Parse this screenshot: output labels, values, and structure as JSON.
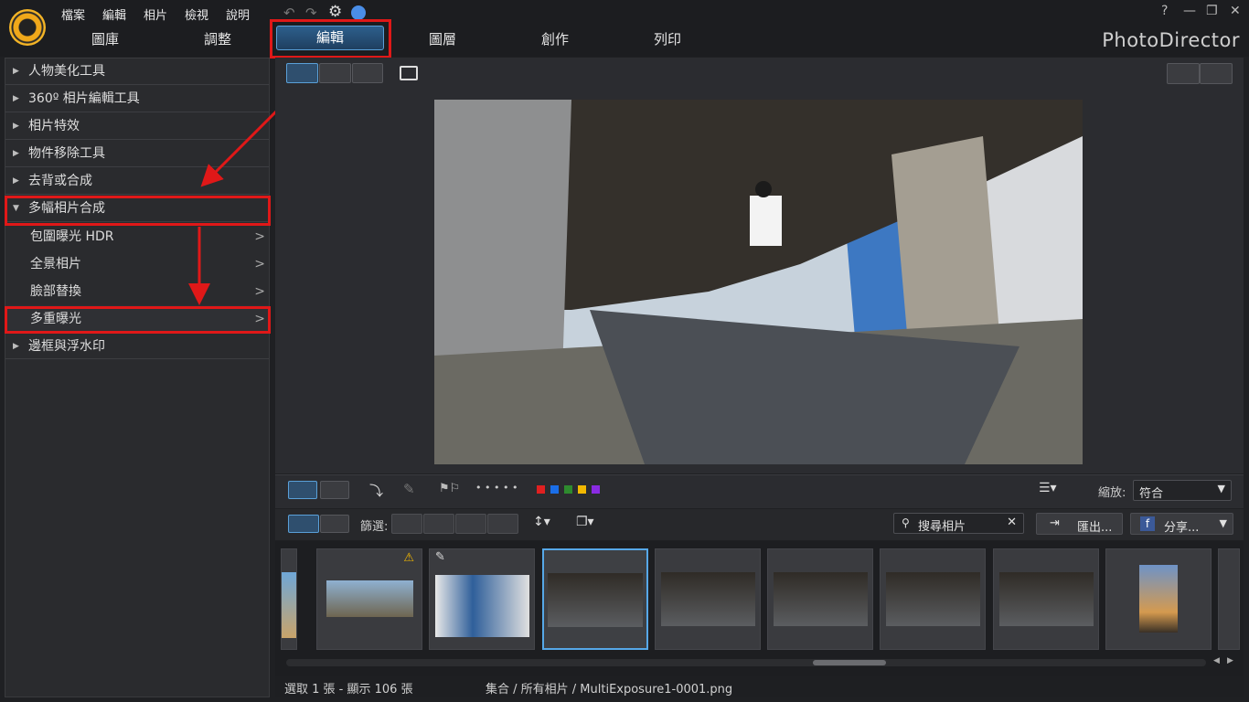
{
  "menu": [
    "檔案",
    "編輯",
    "相片",
    "檢視",
    "說明"
  ],
  "tabs": {
    "library": "圖庫",
    "adjust": "調整",
    "edit": "編輯",
    "layers": "圖層",
    "create": "創作",
    "print": "列印"
  },
  "brand": "PhotoDirector",
  "window": {
    "help": "?",
    "minimize": "—",
    "restore": "❐",
    "close": "✕"
  },
  "left_panel": {
    "items": [
      {
        "label": "人物美化工具"
      },
      {
        "label": "360º 相片編輯工具"
      },
      {
        "label": "相片特效"
      },
      {
        "label": "物件移除工具"
      },
      {
        "label": "去背或合成"
      },
      {
        "label": "多幅相片合成"
      },
      {
        "label": "邊框與浮水印"
      }
    ],
    "subitems": [
      {
        "label": "包圍曝光 HDR"
      },
      {
        "label": "全景相片"
      },
      {
        "label": "臉部替換"
      },
      {
        "label": "多重曝光"
      }
    ]
  },
  "lower_toolbar": {
    "zoom_label": "縮放:",
    "zoom_value": "符合",
    "dots": "• • • • •",
    "color_labels": [
      "#e02020",
      "#1a6ee8",
      "#2e8b2e",
      "#f2b800",
      "#8a2be2"
    ]
  },
  "filter_bar": {
    "filter_label": "篩選:",
    "search_placeholder": "搜尋相片",
    "export_label": "匯出...",
    "share_label": "分享..."
  },
  "status": {
    "selection": "選取 1 張 - 顯示 106 張",
    "path": "集合 / 所有相片 / MultiExposure1-0001.png"
  },
  "colors": {
    "accent": "#5aa0d8",
    "highlight": "#e01818"
  }
}
